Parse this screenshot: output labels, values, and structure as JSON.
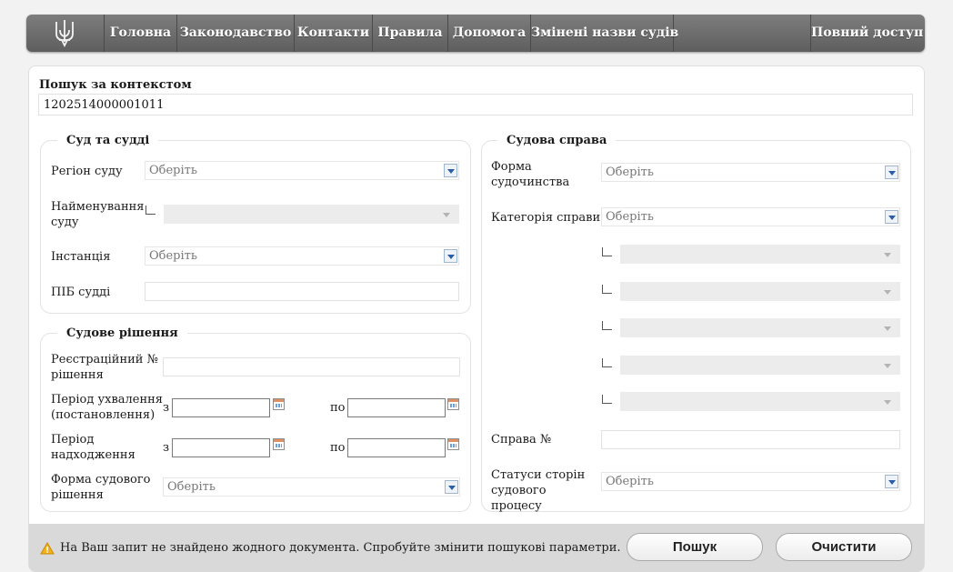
{
  "nav": {
    "items": [
      "Головна",
      "Законодавство",
      "Контакти",
      "Правила",
      "Допомога",
      "Змінені назви судів"
    ],
    "right": "Повний доступ"
  },
  "search": {
    "label": "Пошук за контекстом",
    "value": "1202514000001011"
  },
  "court": {
    "legend": "Суд та судді",
    "region_label": "Регіон суду",
    "region_value": "Оберіть",
    "name_label": "Найменування суду",
    "instance_label": "Інстанція",
    "instance_value": "Оберіть",
    "judge_label": "ПІБ судді"
  },
  "decision": {
    "legend": "Судове рішення",
    "reg_label": "Реєстраційний № рішення",
    "adopt_label": "Період ухвалення (постановлення)",
    "receipt_label": "Період надходження",
    "from": "з",
    "to": "по",
    "form_label": "Форма судового рішення",
    "form_value": "Оберіть"
  },
  "case": {
    "legend": "Судова справа",
    "proc_label": "Форма судочинства",
    "proc_value": "Оберіть",
    "category_label": "Категорія справи",
    "category_value": "Оберіть",
    "number_label": "Справа №",
    "status_label": "Статуси сторін судового процесу",
    "status_value": "Оберіть"
  },
  "footer": {
    "message": "На Ваш запит не знайдено жодного документа. Спробуйте змінити пошукові параметри.",
    "search_button": "Пошук",
    "clear_button": "Очистити"
  }
}
